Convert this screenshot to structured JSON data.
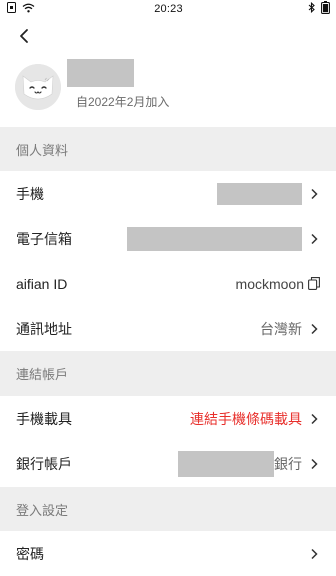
{
  "status_bar": {
    "time": "20:23",
    "icons_left": [
      "notification-icon",
      "wifi-icon"
    ],
    "icons_right": [
      "bluetooth-icon",
      "battery-icon"
    ]
  },
  "profile": {
    "joined_text": "自2022年2月加入"
  },
  "sections": {
    "personal": {
      "title": "個人資料"
    },
    "linked": {
      "title": "連結帳戶"
    },
    "login": {
      "title": "登入設定"
    }
  },
  "rows": {
    "phone": {
      "label": "手機"
    },
    "email": {
      "label": "電子信箱"
    },
    "aifian_id": {
      "label": "aifian ID",
      "value": "mockmoon"
    },
    "address": {
      "label": "通訊地址",
      "value": "台灣新"
    },
    "carrier": {
      "label": "手機載具",
      "value": "連結手機條碼載具"
    },
    "bank": {
      "label": "銀行帳戶",
      "value": "銀行"
    },
    "password": {
      "label": "密碼"
    }
  },
  "colors": {
    "accent_red": "#e8302c",
    "section_bg": "#eeeeee",
    "redaction": "#c4c4c4"
  }
}
